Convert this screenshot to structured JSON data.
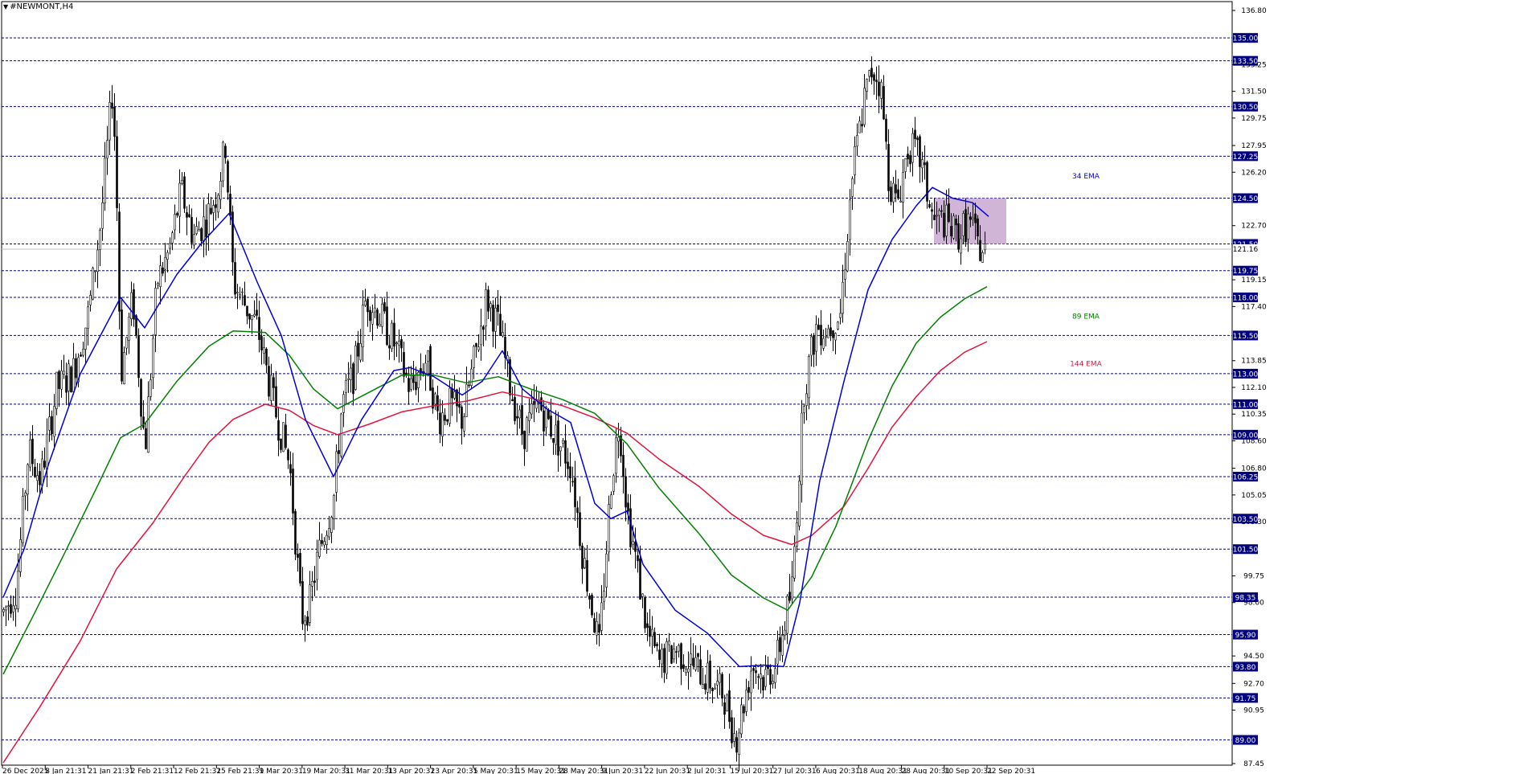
{
  "window": {
    "symbol": "#NEWMONT,H4"
  },
  "colors": {
    "background": "#ffffff",
    "grid": "#000080",
    "candle": "#000000",
    "ema34": "#0000d8",
    "ema89": "#008000",
    "ema144": "#e0143c",
    "zone": "#c8a8d0",
    "current_line": "#c0c0c0",
    "level_badge": "#000080"
  },
  "chart_data": {
    "type": "candlestick",
    "ylim": [
      87.45,
      137.5
    ],
    "y_ticks": [
      "136.80",
      "133.25",
      "131.50",
      "129.75",
      "127.95",
      "126.20",
      "122.70",
      "119.15",
      "117.40",
      "113.85",
      "112.10",
      "110.35",
      "108.60",
      "106.80",
      "105.05",
      "103.30",
      "99.75",
      "98.00",
      "94.50",
      "92.70",
      "90.95",
      "87.45"
    ],
    "levels": [
      "135.00",
      "133.50",
      "130.50",
      "127.25",
      "124.50",
      "121.50",
      "119.75",
      "118.00",
      "115.50",
      "113.00",
      "111.00",
      "109.00",
      "106.25",
      "103.50",
      "101.50",
      "98.35",
      "95.90",
      "93.80",
      "91.75",
      "89.00"
    ],
    "current_price": "121.16",
    "x_ticks": [
      "26 Dec 2025",
      "8 Jan 21:31",
      "21 Jan 21:31",
      "2 Feb 21:31",
      "12 Feb 21:31",
      "25 Feb 21:31",
      "9 Mar 20:31",
      "19 Mar 20:31",
      "31 Mar 20:31",
      "13 Apr 20:31",
      "23 Apr 20:31",
      "5 May 20:31",
      "15 May 20:31",
      "28 May 20:31",
      "9 Jun 20:31",
      "22 Jun 20:31",
      "2 Jul 20:31",
      "15 Jul 20:31",
      "27 Jul 20:31",
      "6 Aug 20:31",
      "18 Aug 20:31",
      "28 Aug 20:31",
      "10 Sep 20:31",
      "22 Sep 20:31"
    ],
    "annotations": {
      "ema34": "34 EMA",
      "ema89": "89 EMA",
      "ema144": "144 EMA"
    },
    "price_path": [
      [
        0,
        97
      ],
      [
        20,
        99
      ],
      [
        35,
        108
      ],
      [
        50,
        106
      ],
      [
        70,
        112
      ],
      [
        90,
        113
      ],
      [
        110,
        117
      ],
      [
        125,
        123
      ],
      [
        140,
        132
      ],
      [
        145,
        124
      ],
      [
        150,
        113
      ],
      [
        165,
        118
      ],
      [
        180,
        108
      ],
      [
        195,
        119
      ],
      [
        210,
        121
      ],
      [
        225,
        125
      ],
      [
        240,
        122
      ],
      [
        255,
        123
      ],
      [
        270,
        125
      ],
      [
        280,
        128
      ],
      [
        290,
        119
      ],
      [
        300,
        118
      ],
      [
        320,
        116
      ],
      [
        340,
        111
      ],
      [
        360,
        107
      ],
      [
        375,
        97
      ],
      [
        385,
        98
      ],
      [
        395,
        101
      ],
      [
        405,
        103
      ],
      [
        415,
        105
      ],
      [
        425,
        111
      ],
      [
        440,
        113
      ],
      [
        455,
        118
      ],
      [
        470,
        117
      ],
      [
        490,
        115
      ],
      [
        510,
        112
      ],
      [
        530,
        114
      ],
      [
        545,
        110
      ],
      [
        560,
        111
      ],
      [
        575,
        110
      ],
      [
        590,
        114
      ],
      [
        605,
        118
      ],
      [
        620,
        116
      ],
      [
        635,
        112
      ],
      [
        650,
        109
      ],
      [
        670,
        111
      ],
      [
        690,
        109
      ],
      [
        710,
        107
      ],
      [
        725,
        101
      ],
      [
        745,
        95
      ],
      [
        760,
        106
      ],
      [
        770,
        110
      ],
      [
        780,
        104
      ],
      [
        790,
        101
      ],
      [
        805,
        96
      ],
      [
        820,
        94
      ],
      [
        840,
        95
      ],
      [
        860,
        94
      ],
      [
        880,
        93
      ],
      [
        900,
        92
      ],
      [
        915,
        89
      ],
      [
        935,
        94
      ],
      [
        950,
        93
      ],
      [
        965,
        94
      ],
      [
        985,
        99
      ],
      [
        1000,
        112
      ],
      [
        1015,
        116
      ],
      [
        1030,
        116
      ],
      [
        1045,
        117
      ],
      [
        1060,
        126
      ],
      [
        1075,
        131
      ],
      [
        1085,
        133
      ],
      [
        1095,
        132
      ],
      [
        1105,
        126
      ],
      [
        1115,
        124
      ],
      [
        1130,
        128
      ],
      [
        1145,
        127
      ],
      [
        1160,
        123
      ],
      [
        1175,
        123
      ],
      [
        1190,
        122
      ],
      [
        1205,
        123
      ],
      [
        1220,
        121
      ]
    ],
    "ema34_path": [
      [
        4,
        98.35
      ],
      [
        30,
        101.5
      ],
      [
        60,
        107
      ],
      [
        100,
        113
      ],
      [
        150,
        118
      ],
      [
        180,
        116
      ],
      [
        220,
        119.5
      ],
      [
        250,
        121.5
      ],
      [
        285,
        123.5
      ],
      [
        320,
        119
      ],
      [
        350,
        115.5
      ],
      [
        380,
        110
      ],
      [
        415,
        106.25
      ],
      [
        450,
        110
      ],
      [
        490,
        113.2
      ],
      [
        510,
        113.4
      ],
      [
        540,
        112.8
      ],
      [
        575,
        111.6
      ],
      [
        600,
        112.5
      ],
      [
        625,
        114.5
      ],
      [
        650,
        112
      ],
      [
        680,
        110.7
      ],
      [
        710,
        109.8
      ],
      [
        740,
        104.5
      ],
      [
        760,
        103.5
      ],
      [
        780,
        104
      ],
      [
        800,
        100.5
      ],
      [
        840,
        97.5
      ],
      [
        880,
        96
      ],
      [
        920,
        93.8
      ],
      [
        950,
        93.9
      ],
      [
        975,
        93.8
      ],
      [
        995,
        98
      ],
      [
        1020,
        106
      ],
      [
        1050,
        112.5
      ],
      [
        1080,
        118.5
      ],
      [
        1110,
        121.8
      ],
      [
        1140,
        124
      ],
      [
        1160,
        125.2
      ],
      [
        1185,
        124.5
      ],
      [
        1210,
        124.2
      ],
      [
        1230,
        123.3
      ]
    ],
    "ema89_path": [
      [
        4,
        93.3
      ],
      [
        40,
        97
      ],
      [
        80,
        101.2
      ],
      [
        120,
        105.5
      ],
      [
        150,
        108.8
      ],
      [
        180,
        109.7
      ],
      [
        220,
        112.5
      ],
      [
        260,
        114.8
      ],
      [
        290,
        115.8
      ],
      [
        330,
        115.7
      ],
      [
        360,
        114.2
      ],
      [
        390,
        112
      ],
      [
        420,
        110.7
      ],
      [
        460,
        111.8
      ],
      [
        500,
        112.9
      ],
      [
        540,
        112.9
      ],
      [
        580,
        112.4
      ],
      [
        620,
        112.8
      ],
      [
        660,
        112
      ],
      [
        700,
        111.3
      ],
      [
        740,
        110.4
      ],
      [
        780,
        108.4
      ],
      [
        820,
        105.5
      ],
      [
        870,
        102.5
      ],
      [
        910,
        99.8
      ],
      [
        950,
        98.3
      ],
      [
        980,
        97.5
      ],
      [
        1010,
        99.7
      ],
      [
        1040,
        103
      ],
      [
        1080,
        108.6
      ],
      [
        1110,
        112.2
      ],
      [
        1140,
        115
      ],
      [
        1170,
        116.7
      ],
      [
        1200,
        117.9
      ],
      [
        1228,
        118.7
      ]
    ],
    "ema144_path": [
      [
        4,
        87.5
      ],
      [
        50,
        91.2
      ],
      [
        100,
        95.5
      ],
      [
        145,
        100.2
      ],
      [
        190,
        103.2
      ],
      [
        230,
        106.3
      ],
      [
        260,
        108.5
      ],
      [
        290,
        110
      ],
      [
        330,
        111
      ],
      [
        360,
        110.6
      ],
      [
        390,
        109.6
      ],
      [
        420,
        109
      ],
      [
        460,
        109.7
      ],
      [
        500,
        110.5
      ],
      [
        540,
        110.9
      ],
      [
        580,
        111.2
      ],
      [
        625,
        111.8
      ],
      [
        660,
        111.4
      ],
      [
        700,
        110.9
      ],
      [
        740,
        110.1
      ],
      [
        780,
        109.1
      ],
      [
        820,
        107.4
      ],
      [
        870,
        105.6
      ],
      [
        910,
        103.8
      ],
      [
        950,
        102.4
      ],
      [
        985,
        101.8
      ],
      [
        1010,
        102.4
      ],
      [
        1050,
        104.3
      ],
      [
        1080,
        106.8
      ],
      [
        1110,
        109.5
      ],
      [
        1140,
        111.5
      ],
      [
        1170,
        113.2
      ],
      [
        1200,
        114.4
      ],
      [
        1228,
        115.1
      ]
    ],
    "zone_box": {
      "x_from": 1162,
      "x_to": 1252,
      "y_top": 124.5,
      "y_bottom": 121.5
    }
  }
}
